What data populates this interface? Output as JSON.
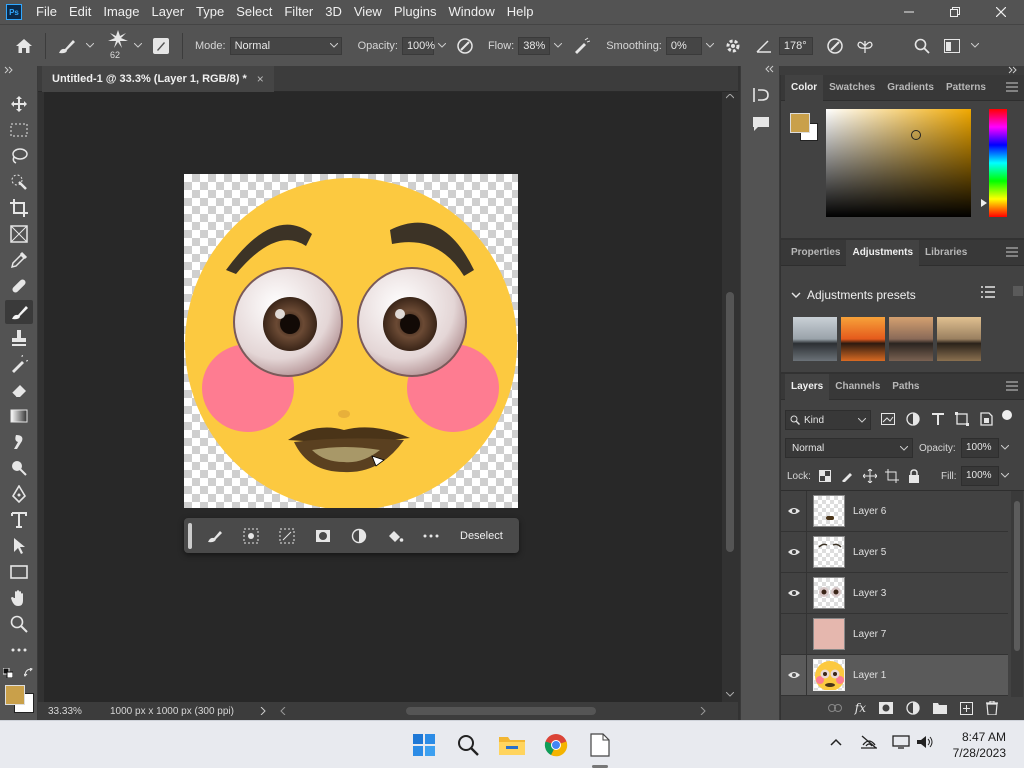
{
  "app": {
    "logo": "Ps"
  },
  "menu": [
    "File",
    "Edit",
    "Image",
    "Layer",
    "Type",
    "Select",
    "Filter",
    "3D",
    "View",
    "Plugins",
    "Window",
    "Help"
  ],
  "options": {
    "brush_size": "62",
    "mode_label": "Mode:",
    "mode_value": "Normal",
    "opacity_label": "Opacity:",
    "opacity_value": "100%",
    "flow_label": "Flow:",
    "flow_value": "38%",
    "smoothing_label": "Smoothing:",
    "smoothing_value": "0%",
    "angle_value": "178°"
  },
  "document": {
    "tab_title": "Untitled-1 @ 33.3% (Layer 1, RGB/8) *",
    "close": "×"
  },
  "status": {
    "zoom": "33.33%",
    "doc_info": "1000 px x 1000 px (300 ppi)"
  },
  "context_bar": {
    "deselect_label": "Deselect"
  },
  "colors": {
    "foreground": "#c9a04a",
    "background": "#ffffff",
    "canvas_bg": "#282828",
    "face": "#fcc940",
    "cheek": "#fe7c91"
  },
  "color_panel": {
    "tabs": [
      "Color",
      "Swatches",
      "Gradients",
      "Patterns"
    ],
    "active": 0
  },
  "adjustments_panel": {
    "tabs": [
      "Properties",
      "Adjustments",
      "Libraries"
    ],
    "active": 1,
    "section_title": "Adjustments presets"
  },
  "layers_panel": {
    "tabs": [
      "Layers",
      "Channels",
      "Paths"
    ],
    "active": 0,
    "filter_label": "Kind",
    "blend_mode": "Normal",
    "opacity_label": "Opacity:",
    "opacity_value": "100%",
    "lock_label": "Lock:",
    "fill_label": "Fill:",
    "fill_value": "100%",
    "layers": [
      {
        "name": "Layer 6",
        "visible": true
      },
      {
        "name": "Layer 5",
        "visible": true
      },
      {
        "name": "Layer 3",
        "visible": true
      },
      {
        "name": "Layer 7",
        "visible": false
      },
      {
        "name": "Layer 1",
        "visible": true
      }
    ]
  },
  "taskbar": {
    "time": "8:47 AM",
    "date": "7/28/2023"
  }
}
